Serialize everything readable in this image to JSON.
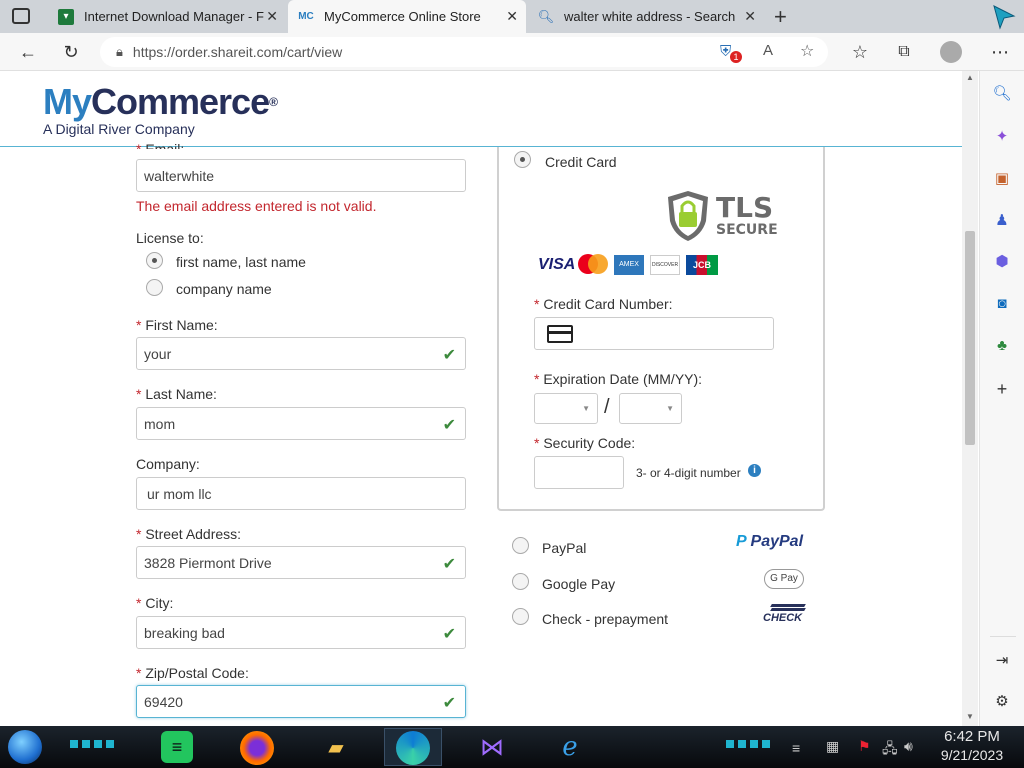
{
  "browser": {
    "tabs": [
      {
        "title": "Internet Download Manager - Fr",
        "icon": "idm-icon"
      },
      {
        "title": "MyCommerce Online Store",
        "icon": "mycommerce-icon",
        "icon_text": "MC"
      },
      {
        "title": "walter white address - Search",
        "icon": "search-icon"
      }
    ],
    "url": "https://order.shareit.com/cart/view"
  },
  "logo": {
    "my": "My",
    "commerce": "Commerce",
    "reg": "®",
    "subtitle": "A Digital River Company"
  },
  "form": {
    "email_label": "Email:",
    "email_value": "walterwhite",
    "email_error": "The email address entered is not valid.",
    "license_label": "License to:",
    "license_options": [
      "first name, last name",
      "company name"
    ],
    "first_name_label": "First Name:",
    "first_name_value": "your",
    "last_name_label": "Last Name:",
    "last_name_value": "mom",
    "company_label": "Company:",
    "company_value": "ur mom llc",
    "street_label": "Street Address:",
    "street_value": "3828 Piermont Drive",
    "city_label": "City:",
    "city_value": "breaking bad",
    "zip_label": "Zip/Postal Code:",
    "zip_value": "69420",
    "required_mark": "*"
  },
  "payment": {
    "credit_card_label": "Credit Card",
    "tls_title": "TLS",
    "tls_sub": "SECURE",
    "card_brands": [
      "VISA",
      "AMEX",
      "DISCOVER",
      "JCB"
    ],
    "cc_number_label": "Credit Card Number:",
    "expiration_label": "Expiration Date (MM/YY):",
    "expiration_separator": "/",
    "security_label": "Security Code:",
    "security_hint": "3- or 4-digit number",
    "other_methods": [
      {
        "label": "PayPal",
        "logo": "PayPal"
      },
      {
        "label": "Google Pay",
        "logo": "G Pay"
      },
      {
        "label": "Check - prepayment",
        "logo": "CHECK"
      }
    ]
  },
  "taskbar": {
    "time": "6:42 PM",
    "date": "9/21/2023"
  },
  "colors": {
    "brand_blue": "#2c7fc0",
    "brand_navy": "#27305a",
    "error_red": "#c3272e",
    "valid_green": "#3c8a3c",
    "paypal_blue": "#253b80"
  }
}
